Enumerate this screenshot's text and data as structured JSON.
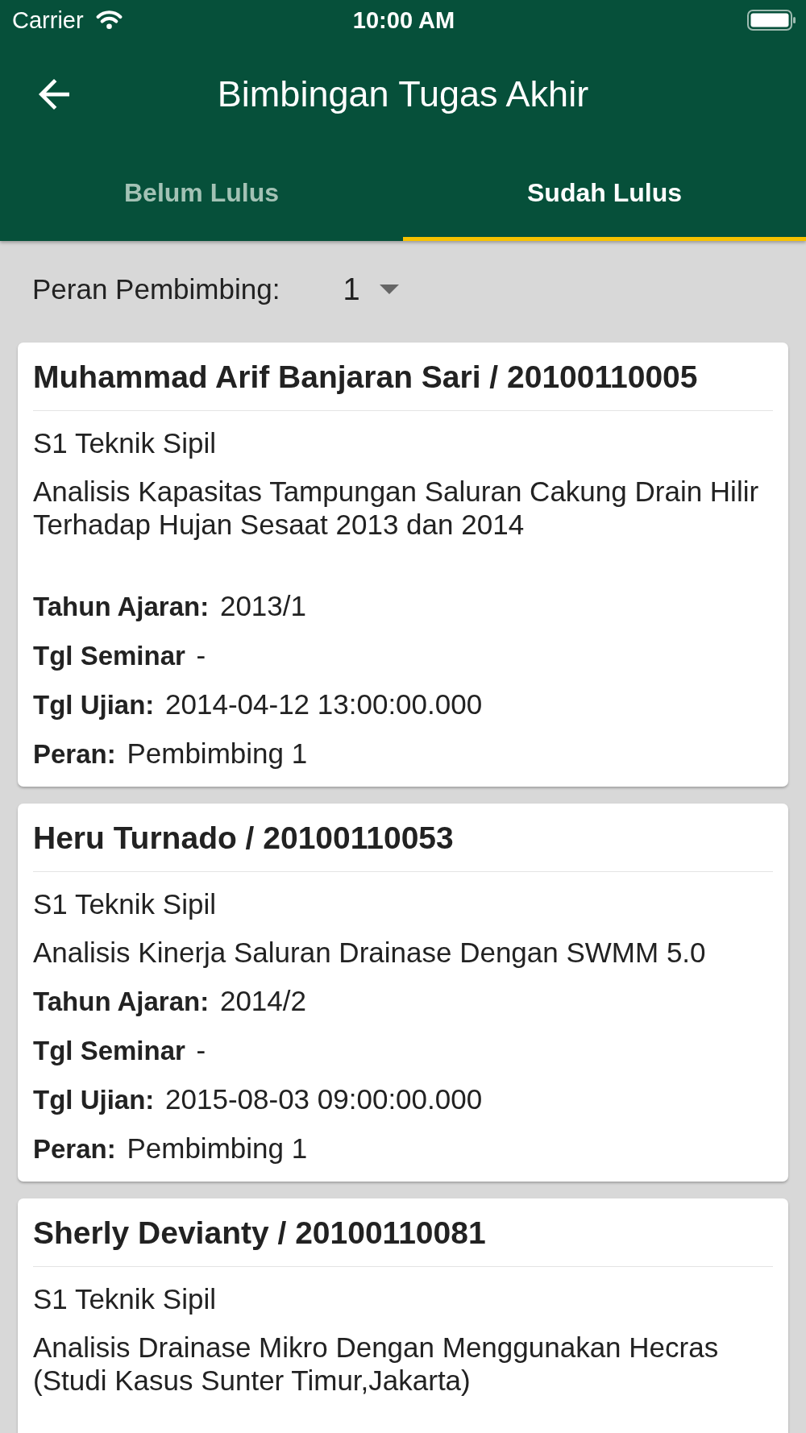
{
  "status_bar": {
    "carrier": "Carrier",
    "time": "10:00 AM"
  },
  "app_bar": {
    "title": "Bimbingan Tugas Akhir"
  },
  "tabs": [
    {
      "label": "Belum Lulus",
      "selected": false
    },
    {
      "label": "Sudah Lulus",
      "selected": true
    }
  ],
  "filter": {
    "label": "Peran Pembimbing:",
    "value": "1"
  },
  "students": [
    {
      "title": "Muhammad Arif Banjaran Sari / 20100110005",
      "program": "S1 Teknik Sipil",
      "thesis": "Analisis Kapasitas Tampungan Saluran Cakung Drain Hilir Terhadap Hujan Sesaat 2013 dan 2014\n",
      "details": [
        "**Tahun Ajaran:** 2013/1",
        "**Tgl Seminar** -",
        "**Tgl Ujian:** 2014-04-12 13:00:00.000",
        "**Peran:** Pembimbing 1"
      ]
    },
    {
      "title": "Heru Turnado / 20100110053",
      "program": "S1 Teknik Sipil",
      "thesis": "Analisis Kinerja Saluran Drainase Dengan SWMM 5.0",
      "details": [
        "**Tahun Ajaran:** 2014/2",
        "**Tgl Seminar** -",
        "**Tgl Ujian:** 2015-08-03 09:00:00.000",
        "**Peran:** Pembimbing 1"
      ]
    },
    {
      "title": "Sherly Devianty / 20100110081",
      "program": "S1 Teknik Sipil",
      "thesis": "Analisis Drainase Mikro Dengan Menggunakan Hecras (Studi Kasus Sunter Timur,Jakarta)\n"
    }
  ]
}
